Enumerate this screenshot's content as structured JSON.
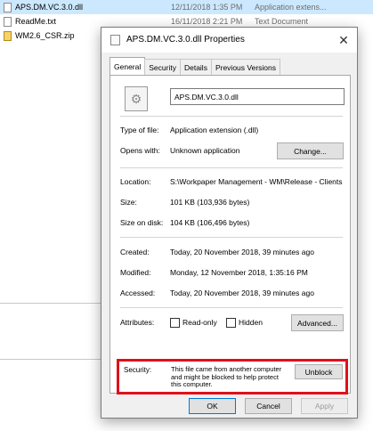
{
  "explorer": {
    "files": [
      {
        "name": "APS.DM.VC.3.0.dll",
        "date": "12/11/2018 1:35 PM",
        "type": "Application extens..."
      },
      {
        "name": "ReadMe.txt",
        "date": "16/11/2018 2:21 PM",
        "type": "Text Document"
      },
      {
        "name": "WM2.6_CSR.zip",
        "date": "",
        "type": ""
      }
    ]
  },
  "dialog": {
    "title": "APS.DM.VC.3.0.dll Properties",
    "close_glyph": "✕",
    "tabs": [
      "General",
      "Security",
      "Details",
      "Previous Versions"
    ],
    "active_tab": "General",
    "file_name": "APS.DM.VC.3.0.dll",
    "type_of_file_label": "Type of file:",
    "type_of_file": "Application extension (.dll)",
    "opens_with_label": "Opens with:",
    "opens_with": "Unknown application",
    "change_button": "Change...",
    "location_label": "Location:",
    "location": "S:\\Workpaper Management - WM\\Release - Clients",
    "size_label": "Size:",
    "size": "101 KB (103,936 bytes)",
    "size_on_disk_label": "Size on disk:",
    "size_on_disk": "104 KB (106,496 bytes)",
    "created_label": "Created:",
    "created": "Today, 20 November 2018, 39 minutes ago",
    "modified_label": "Modified:",
    "modified": "Monday, 12 November 2018, 1:35:16 PM",
    "accessed_label": "Accessed:",
    "accessed": "Today, 20 November 2018, 39 minutes ago",
    "attributes_label": "Attributes:",
    "readonly_label": "Read-only",
    "hidden_label": "Hidden",
    "advanced_button": "Advanced...",
    "security_label": "Security:",
    "security_text": "This file came from another computer and might be blocked to help protect this computer.",
    "unblock_button": "Unblock",
    "ok_button": "OK",
    "cancel_button": "Cancel",
    "apply_button": "Apply"
  }
}
